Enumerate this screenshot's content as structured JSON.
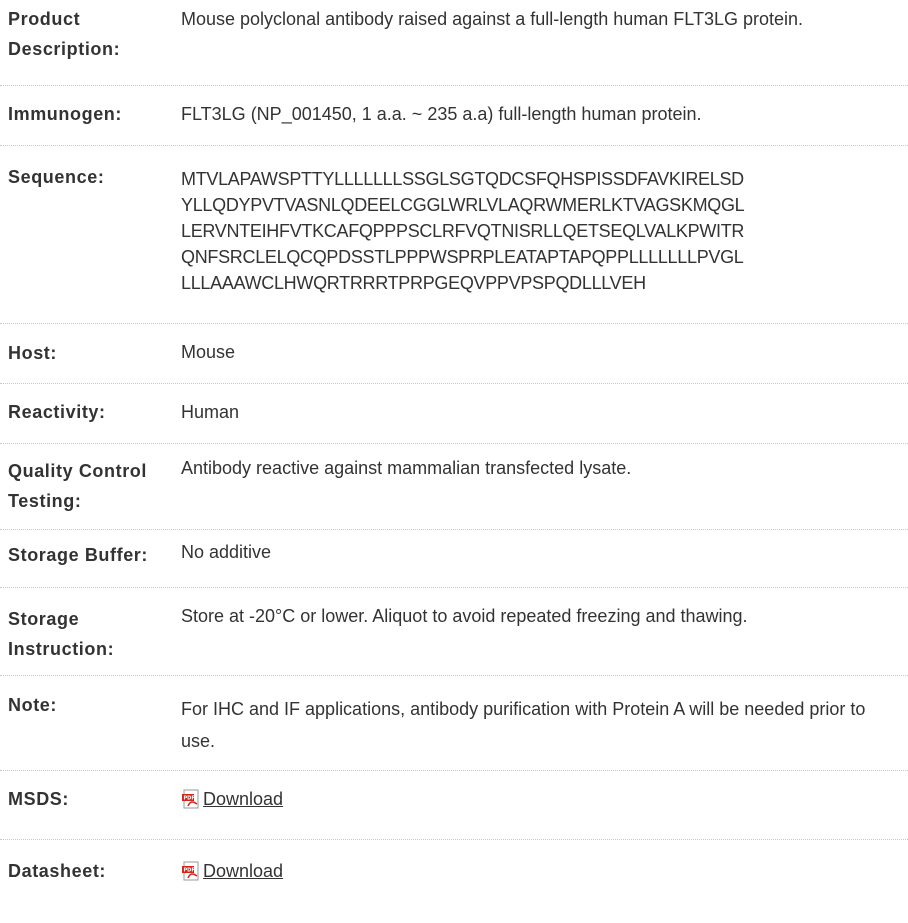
{
  "rows": {
    "description": {
      "label_line1": "Product",
      "label_line2": "Description:",
      "value": "Mouse polyclonal antibody raised against a full-length human FLT3LG protein."
    },
    "immunogen": {
      "label": "Immunogen:",
      "value": "FLT3LG (NP_001450, 1 a.a. ~ 235 a.a) full-length human protein."
    },
    "sequence": {
      "label": "Sequence:",
      "lines": [
        "MTVLAPAWSPTTYLLLLLLLSSGLSGTQDCSFQHSPISSDFAVKIRELSD",
        "YLLQDYPVTVASNLQDEELCGGLWRLVLAQRWMERLKTVAGSKMQGL",
        "LERVNTEIHFVTKCAFQPPPSCLRFVQTNISRLLQETSEQLVALKPWITR",
        "QNFSRCLELQCQPDSSTLPPPWSPRPLEATAPTAPQPPLLLLLLLPVGL",
        "LLLAAAWCLHWQRTRRRTPRPGEQVPPVPSPQDLLLVEH"
      ]
    },
    "host": {
      "label": "Host:",
      "value": "Mouse"
    },
    "reactivity": {
      "label": "Reactivity:",
      "value": "Human"
    },
    "quality_control": {
      "label_line1": "Quality Control",
      "label_line2": "Testing:",
      "value": "Antibody reactive against mammalian transfected lysate."
    },
    "storage_buffer": {
      "label": "Storage Buffer:",
      "value": "No additive"
    },
    "storage_instruction": {
      "label_line1": "Storage",
      "label_line2": "Instruction:",
      "value": "Store at -20°C or lower. Aliquot to avoid repeated freezing and thawing."
    },
    "note": {
      "label": "Note:",
      "value": "For IHC and IF applications, antibody purification with Protein A will be needed prior to use."
    },
    "msds": {
      "label": "MSDS:",
      "link_text": "Download",
      "icon": "pdf-icon"
    },
    "datasheet": {
      "label": "Datasheet:",
      "link_text": "Download",
      "icon": "pdf-icon"
    }
  },
  "colors": {
    "text": "#333333",
    "divider": "#c8c8c8",
    "pdf_red": "#d2261b"
  }
}
